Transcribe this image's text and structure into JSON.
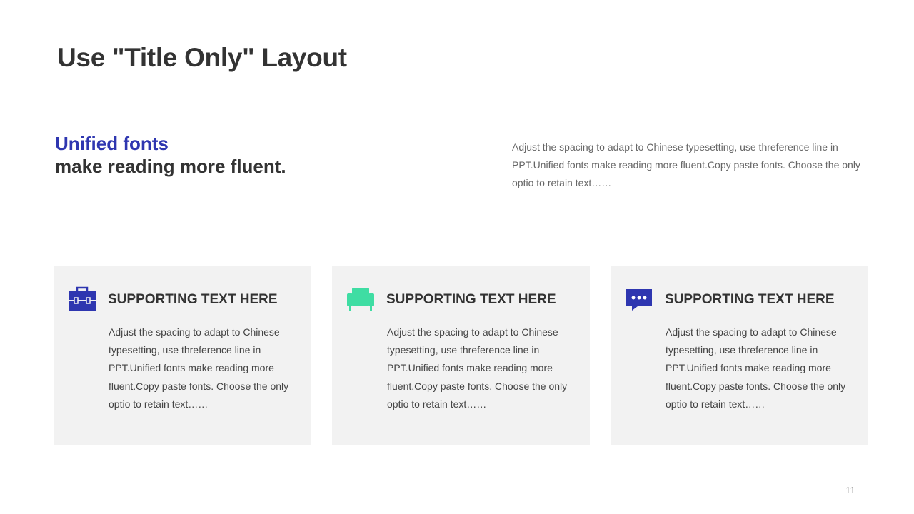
{
  "slide": {
    "title": "Use \"Title Only\" Layout",
    "headline_accent": "Unified fonts",
    "headline_main": "make reading more fluent.",
    "intro_text": "Adjust the spacing to adapt to Chinese typesetting, use threference line in PPT.Unified fonts make reading more fluent.Copy paste fonts. Choose the only optio to retain text……",
    "page_number": "11"
  },
  "colors": {
    "accent_blue": "#2E36B0",
    "accent_green": "#3FDDA3",
    "card_background": "#F2F2F2",
    "title_text": "#333333"
  },
  "cards": [
    {
      "icon": "toolbox-icon",
      "title": "SUPPORTING TEXT HERE",
      "body": "Adjust the spacing to adapt to Chinese typesetting, use threference line in PPT.Unified fonts make reading more fluent.Copy paste fonts. Choose the only optio to retain text……"
    },
    {
      "icon": "sofa-icon",
      "title": "SUPPORTING TEXT HERE",
      "body": "Adjust the spacing to adapt to Chinese typesetting, use threference line in PPT.Unified fonts make reading more fluent.Copy paste fonts. Choose the only optio to retain text……"
    },
    {
      "icon": "chat-bubble-icon",
      "title": "SUPPORTING TEXT HERE",
      "body": "Adjust the spacing to adapt to Chinese typesetting, use threference line in PPT.Unified fonts make reading more fluent.Copy paste fonts. Choose the only optio to retain text……"
    }
  ]
}
